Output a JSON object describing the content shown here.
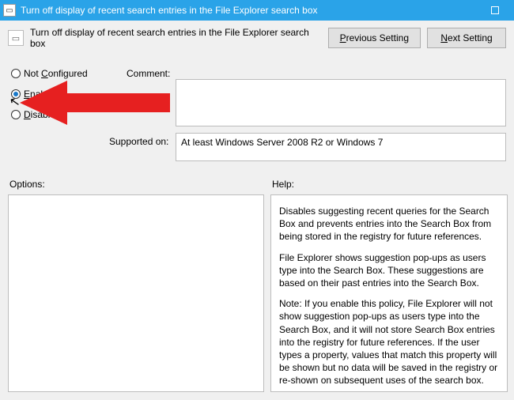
{
  "window": {
    "title": "Turn off display of recent search entries in the File Explorer search box"
  },
  "header": {
    "title": "Turn off display of recent search entries in the File Explorer search box",
    "prev_p": "P",
    "prev_rest": "revious Setting",
    "next_n": "N",
    "next_rest": "ext Setting"
  },
  "radios": {
    "not_configured_c": "C",
    "not_configured_rest_pre": "Not ",
    "not_configured_rest_post": "onfigured",
    "enabled_e": "E",
    "enabled_rest": "nabled",
    "disabled_d": "D",
    "disabled_rest": "isabled"
  },
  "labels": {
    "comment": "Comment:",
    "supported": "Supported on:",
    "options": "Options:",
    "help": "Help:"
  },
  "supported_text": "At least Windows Server 2008 R2 or Windows 7",
  "help_text": {
    "p1": "Disables suggesting recent queries for the Search Box and prevents entries into the Search Box from being stored in the registry for future references.",
    "p2": "File Explorer shows suggestion pop-ups as users type into the Search Box.  These suggestions are based on their past entries into the Search Box.",
    "p3": "Note: If you enable this policy, File Explorer will not show suggestion pop-ups as users type into the Search Box, and it will not store Search Box entries into the registry for future references.  If the user types a property, values that match this property will be shown but no data will be saved in the registry or re-shown on subsequent uses of the search box."
  }
}
